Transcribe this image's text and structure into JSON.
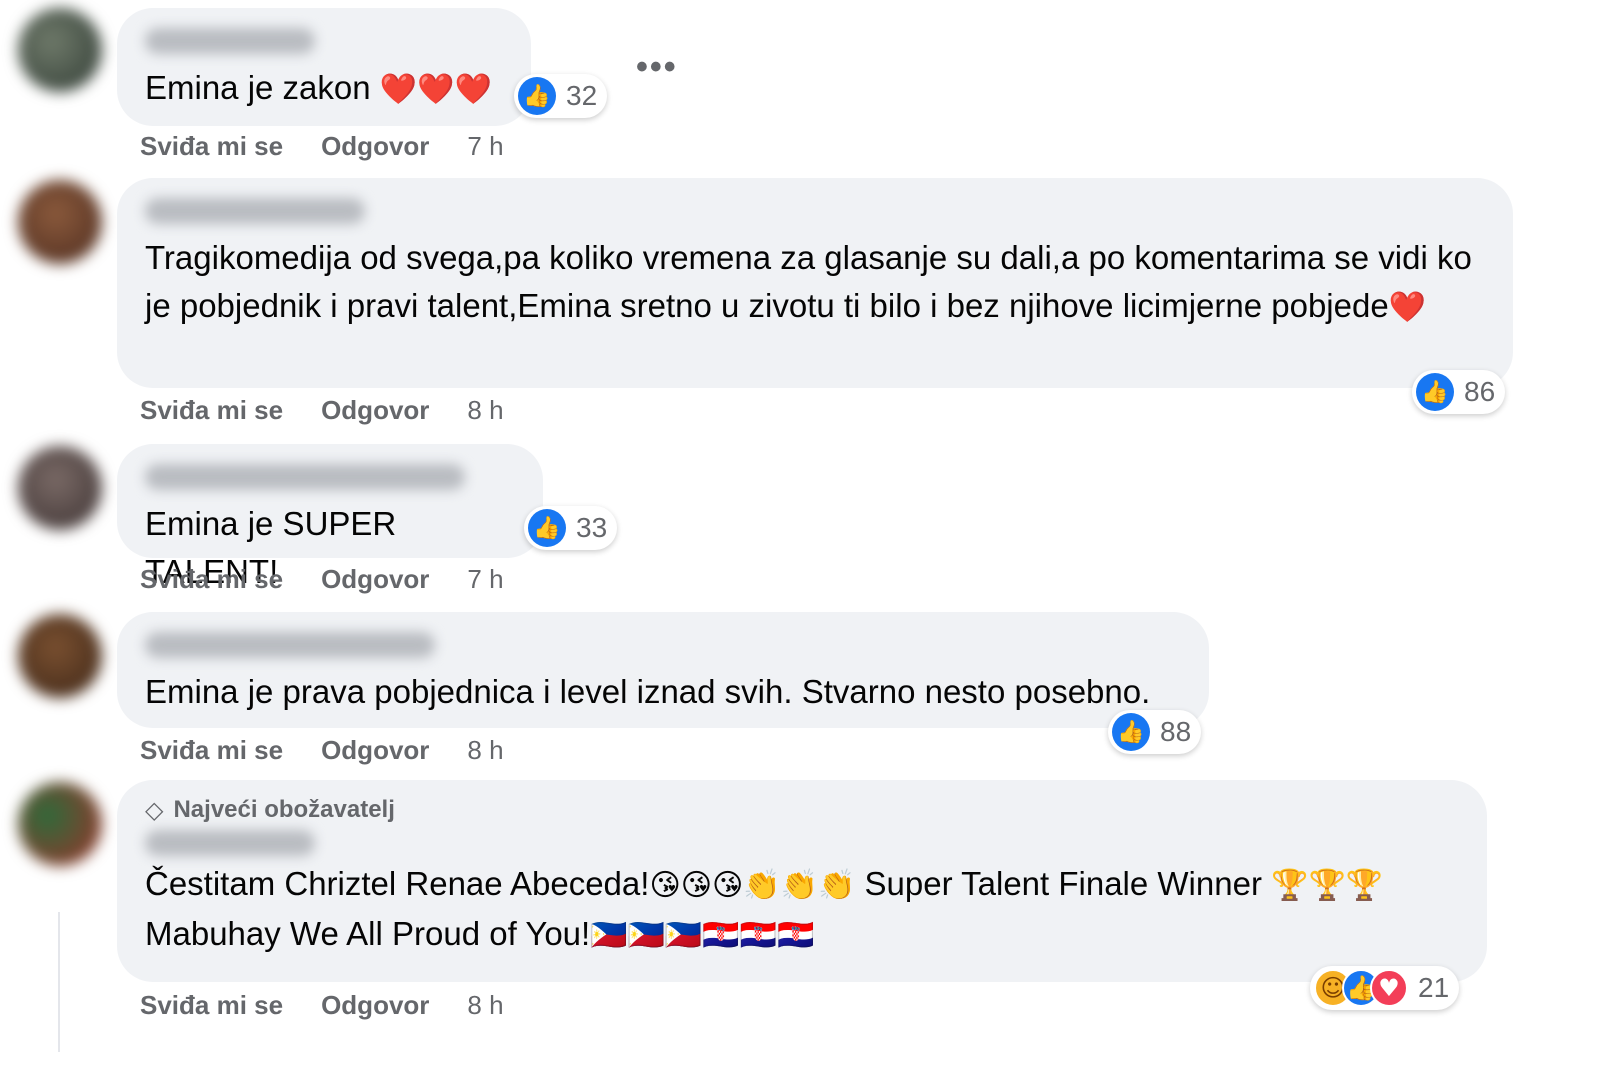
{
  "actions": {
    "like_label": "Sviđa mi se",
    "reply_label": "Odgovor"
  },
  "comments": [
    {
      "text": "Emina je zakon",
      "emojis": "❤️❤️❤️",
      "reaction_count": "32",
      "time": "7 h"
    },
    {
      "text": "Tragikomedija od svega,pa koliko vremena za glasanje su dali,a po komentarima se vidi ko je pobjednik i pravi talent,Emina sretno u zivotu ti bilo i bez njihove licimjerne pobjede",
      "emojis": "❤️",
      "reaction_count": "86",
      "time": "8 h"
    },
    {
      "text": "Emina je SUPER TALENT!",
      "reaction_count": "33",
      "time": "7 h"
    },
    {
      "text": "Emina je prava pobjednica i level iznad svih. Stvarno nesto posebno.",
      "reaction_count": "88",
      "time": "8 h"
    },
    {
      "badge": "Najveći obožavatelj",
      "line1_text": "Čestitam Chriztel Renae Abeceda!",
      "line1_emojis": "😘😘😘👏👏👏",
      "line1_text2": " Super Talent Finale Winner ",
      "line1_emojis2": "🏆🏆🏆",
      "line2_text": "Mabuhay We All Proud of You!",
      "line2_emojis": "🇵🇭🇵🇭🇵🇭🇭🇷🇭🇷🇭🇷",
      "reaction_count": "21",
      "time": "8 h"
    }
  ],
  "icons": {
    "like": "like-thumb-icon",
    "haha": "haha-icon",
    "love": "love-icon",
    "diamond": "diamond-icon",
    "more": "more-options-icon"
  },
  "colors": {
    "bubble": "#f0f2f5",
    "like_blue": "#1877f2",
    "muted_text": "#65676b",
    "heart_red": "#e41e3f"
  }
}
